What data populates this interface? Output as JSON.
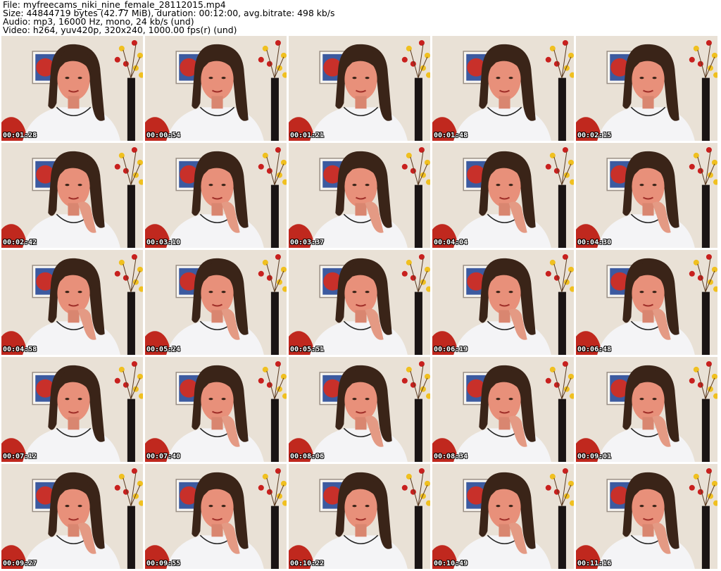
{
  "header": {
    "lines": [
      "File: myfreecams_niki_nine_female_28112015.mp4",
      "Size: 44844719 bytes (42.77 MiB), duration: 00:12:00, avg.bitrate: 498 kb/s",
      "Audio: mp3, 16000 Hz, mono, 24 kb/s (und)",
      "Video: h264, yuv420p, 320x240, 1000.00 fps(r) (und)"
    ]
  },
  "grid": {
    "columns": 5,
    "rows": 5,
    "timestamps": [
      "00:01:28",
      "00:00:54",
      "00:01:21",
      "00:01:48",
      "00:02:15",
      "00:02:42",
      "00:03:10",
      "00:03:37",
      "00:04:04",
      "00:04:30",
      "00:04:58",
      "00:05:24",
      "00:05:51",
      "00:06:19",
      "00:06:48",
      "00:07:12",
      "00:07:40",
      "00:08:06",
      "00:08:34",
      "00:09:01",
      "00:09:27",
      "00:09:55",
      "00:10:22",
      "00:10:49",
      "00:11:16"
    ]
  },
  "colors": {
    "wall": "#e9e1d6",
    "shirt": "#f4f4f6",
    "hair": "#3a2418",
    "skin": "#e8907a",
    "chair": "#c0281e",
    "vase": "#1a1414",
    "flowers_yellow": "#f0c020",
    "painting_blue": "#3c5aa0"
  }
}
